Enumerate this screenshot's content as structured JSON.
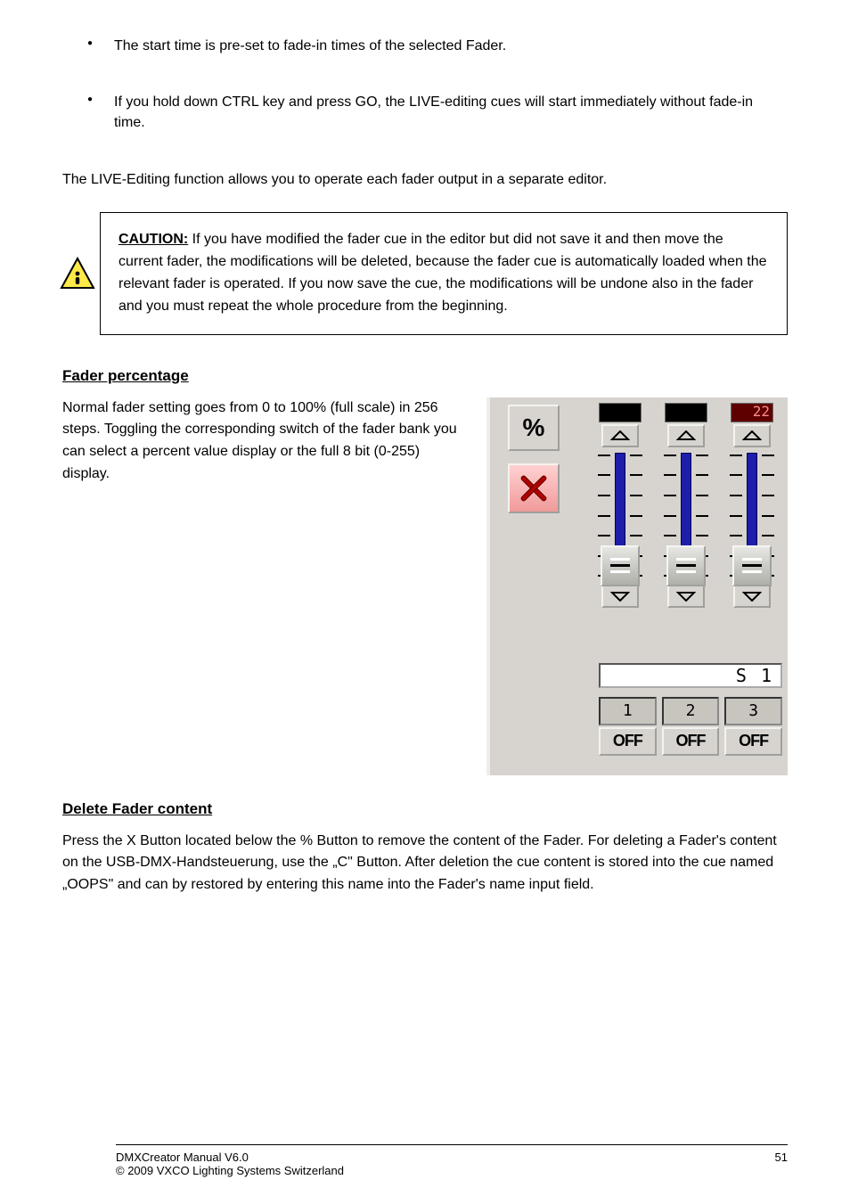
{
  "bullets": [
    "The start time is pre-set to fade-in times of the selected Fader.",
    "If you hold down CTRL key and press GO, the LIVE-editing cues will start immediately without fade-in time."
  ],
  "paragraph_after_bullets": "The LIVE-Editing function allows you to operate each fader output in a separate editor.",
  "caution_label": "CAUTION:",
  "caution_body": "If you have modified the fader cue in the editor but did not save it and then move the current fader, the modifications will be deleted, because the fader cue is automatically loaded when the relevant fader is operated. If you now save the cue, the modifications will be undone also in the fader and you must repeat the whole procedure from the beginning.",
  "section1_heading": "Fader percentage",
  "section1_body": "Normal fader setting goes from 0 to 100% (full scale) in 256 steps. Toggling the corresponding switch of the fader bank you can select a percent value display or the full 8 bit (0-255) display.",
  "section2_heading": "Delete Fader content",
  "section2_body": "Press the X Button located below the % Button to remove the content of the Fader. For deleting a Fader's content on the USB-DMX-Handsteuerung, use the „C\" Button. After deletion the cue content is stored into the cue named „OOPS\" and can by restored by entering this name into the Fader's name input field.",
  "panel": {
    "faders": [
      {
        "value": "",
        "active": false,
        "num": "1",
        "btn": "OFF"
      },
      {
        "value": "",
        "active": false,
        "num": "2",
        "btn": "OFF"
      },
      {
        "value": "22",
        "active": true,
        "num": "3",
        "btn": "OFF"
      }
    ],
    "percent_label": "%",
    "select_label": "S 1"
  },
  "footer": {
    "product": "DMXCreator Manual V6.0",
    "company": "© 2009 VXCO Lighting Systems Switzerland"
  },
  "page_number": "51"
}
